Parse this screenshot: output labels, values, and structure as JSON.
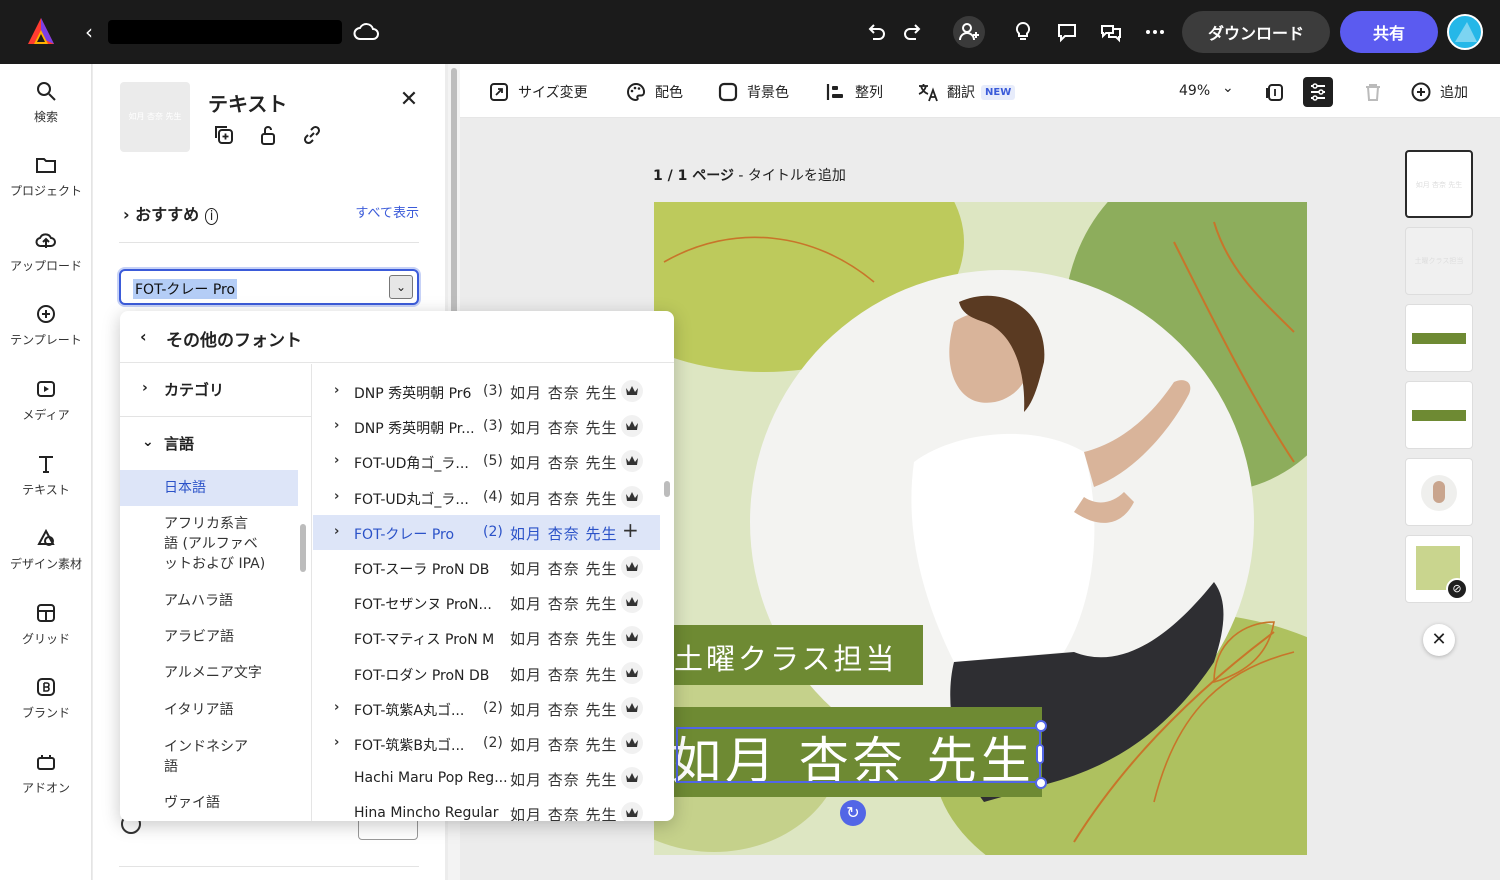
{
  "topbar": {
    "doc_title": "",
    "download_label": "ダウンロード",
    "share_label": "共有"
  },
  "rail": {
    "items": [
      {
        "label": "検索",
        "icon": "search-icon"
      },
      {
        "label": "プロジェクト",
        "icon": "folder-icon"
      },
      {
        "label": "アップロード",
        "icon": "cloud-upload-icon"
      },
      {
        "label": "テンプレート",
        "icon": "template-icon"
      },
      {
        "label": "メディア",
        "icon": "media-icon"
      },
      {
        "label": "テキスト",
        "icon": "text-icon"
      },
      {
        "label": "デザイン素材",
        "icon": "design-assets-icon"
      },
      {
        "label": "グリッド",
        "icon": "grid-icon"
      },
      {
        "label": "ブランド",
        "icon": "brand-icon"
      },
      {
        "label": "アドオン",
        "icon": "addon-icon"
      }
    ]
  },
  "panel": {
    "thumb_text": "如月 杏奈 先生",
    "title": "テキスト",
    "recommended_label": "おすすめ",
    "show_all_label": "すべて表示",
    "font_value": "FOT-クレー Pro"
  },
  "dropdown": {
    "header": "その他のフォント",
    "category_label": "カテゴリ",
    "language_label": "言語",
    "languages": [
      {
        "label": "日本語",
        "selected": true
      },
      {
        "label": "アフリカ系言",
        "selected": false
      },
      {
        "label": "語 (アルファベ",
        "selected": false
      },
      {
        "label": "ットおよび IPA)",
        "selected": false
      },
      {
        "label": "アムハラ語",
        "selected": false
      },
      {
        "label": "アラビア語",
        "selected": false
      },
      {
        "label": "アルメニア文字",
        "selected": false
      },
      {
        "label": "イタリア語",
        "selected": false
      },
      {
        "label": "インドネシア",
        "selected": false
      },
      {
        "label": "語",
        "selected": false
      },
      {
        "label": "ヴァイ語",
        "selected": false
      }
    ],
    "fonts": [
      {
        "name": "DNP 秀英明朝 Pr6",
        "count": "(3)",
        "preview": "如月 杏奈 先生",
        "expand": true,
        "selected": false
      },
      {
        "name": "DNP 秀英明朝 Pr...",
        "count": "(3)",
        "preview": "如月 杏奈 先生",
        "expand": true,
        "selected": false
      },
      {
        "name": "FOT-UD角ゴ_ラ...",
        "count": "(5)",
        "preview": "如月 杏奈 先生",
        "expand": true,
        "selected": false
      },
      {
        "name": "FOT-UD丸ゴ_ラ...",
        "count": "(4)",
        "preview": "如月 杏奈 先生",
        "expand": true,
        "selected": false
      },
      {
        "name": "FOT-クレー Pro",
        "count": "(2)",
        "preview": "如月 杏奈 先生",
        "expand": true,
        "selected": true
      },
      {
        "name": "FOT-スーラ ProN DB",
        "count": "",
        "preview": "如月 杏奈 先生",
        "expand": false,
        "selected": false
      },
      {
        "name": "FOT-セザンヌ ProN...",
        "count": "",
        "preview": "如月 杏奈 先生",
        "expand": false,
        "selected": false
      },
      {
        "name": "FOT-マティス ProN M",
        "count": "",
        "preview": "如月 杏奈 先生",
        "expand": false,
        "selected": false
      },
      {
        "name": "FOT-ロダン ProN DB",
        "count": "",
        "preview": "如月 杏奈 先生",
        "expand": false,
        "selected": false
      },
      {
        "name": "FOT-筑紫A丸ゴ...",
        "count": "(2)",
        "preview": "如月 杏奈 先生",
        "expand": true,
        "selected": false
      },
      {
        "name": "FOT-筑紫B丸ゴ...",
        "count": "(2)",
        "preview": "如月 杏奈 先生",
        "expand": true,
        "selected": false
      },
      {
        "name": "Hachi Maru Pop Reg...",
        "count": "",
        "preview": "如月 杏奈 先生",
        "expand": false,
        "selected": false
      },
      {
        "name": "Hina Mincho Regular",
        "count": "",
        "preview": "如月 杏奈 先生",
        "expand": false,
        "selected": false
      }
    ]
  },
  "canvas_toolbar": {
    "resize_label": "サイズ変更",
    "color_label": "配色",
    "bg_label": "背景色",
    "align_label": "整列",
    "translate_label": "翻訳",
    "new_badge": "NEW",
    "zoom": "49%",
    "add_label": "追加"
  },
  "canvas": {
    "page_label_prefix": "1 / 1 ページ",
    "page_label_sep": " - ",
    "page_title_placeholder": "タイトルを追加",
    "badge_small": "土曜クラス担当",
    "badge_large": "如月 杏奈 先生"
  },
  "thumbs": {
    "t1": "如月 杏奈 先生",
    "t2": "土曜クラス担当"
  },
  "colors": {
    "accent": "#5b5bf0",
    "green_badge": "#6e8a33",
    "selection": "#5266e6"
  }
}
